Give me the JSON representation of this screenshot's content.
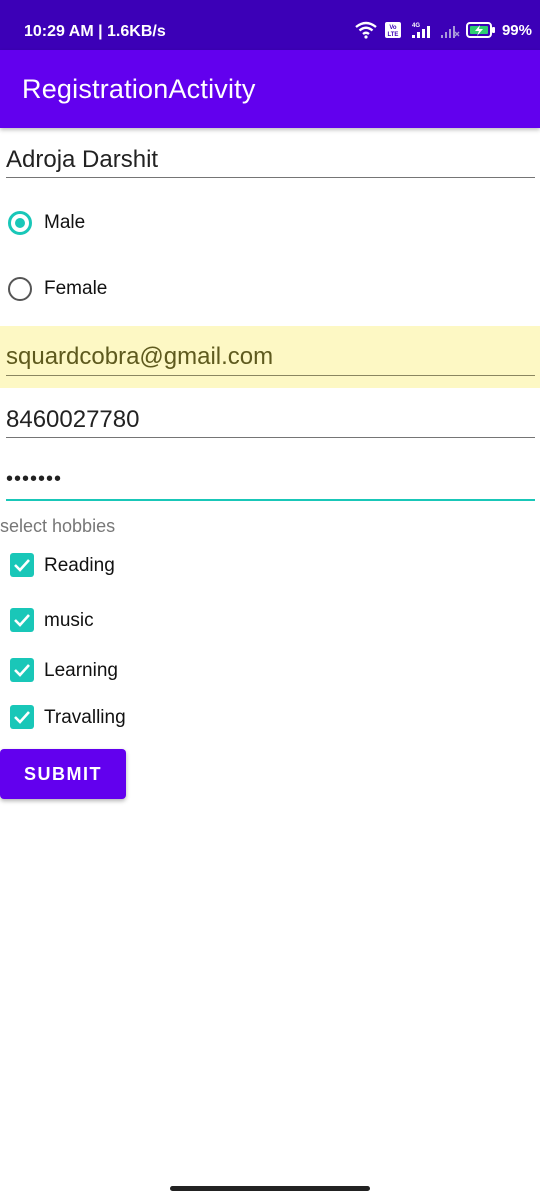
{
  "status_bar": {
    "time": "10:29 AM | 1.6KB/s",
    "battery": "99%",
    "network": "4G",
    "volte": "Vo LTE"
  },
  "app_bar": {
    "title": "RegistrationActivity"
  },
  "form": {
    "name_value": "Adroja Darshit",
    "gender_options": [
      {
        "label": "Male",
        "checked": true
      },
      {
        "label": "Female",
        "checked": false
      }
    ],
    "email_value": "squardcobra@gmail.com",
    "phone_value": "8460027780",
    "password_value": "•••••••",
    "hobbies_hint": "select hobbies",
    "hobbies": [
      {
        "label": "Reading",
        "checked": true
      },
      {
        "label": "music",
        "checked": true
      },
      {
        "label": "Learning",
        "checked": true
      },
      {
        "label": "Travalling",
        "checked": true
      }
    ],
    "submit_label": "SUBMIT"
  },
  "colors": {
    "status_bar": "#3c00b7",
    "app_bar": "#6200ee",
    "accent": "#19c7b8",
    "autofill_background": "#fdf8c4"
  }
}
